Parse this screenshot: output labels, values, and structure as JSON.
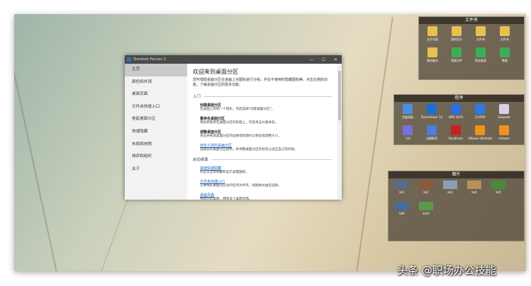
{
  "window": {
    "title": "Stardock Fences 3",
    "controls": [
      "—",
      "☐",
      "✕"
    ]
  },
  "sidebar": [
    "主页",
    "颜色和外观",
    "桌面页面",
    "文件夹快速入口",
    "卷起桌面分区",
    "快速隐藏",
    "布局和快照",
    "排序和组织",
    "关于"
  ],
  "main": {
    "heading": "欢迎来到桌面分区",
    "desc": "您可借助桌面分区在桌面上对图标进行分组，并在不使用时隐藏图标等。点击左侧的功能，了解桌面分区的更多功能。",
    "sections": [
      {
        "title": "入门",
        "items": [
          {
            "t": "创建桌面分区",
            "d": "在桌面上绘制一个矩形，然后选择\"创建桌面分区\"。",
            "link": false
          },
          {
            "t": "重命名桌面分区",
            "d": "将鼠标悬停在桌面分区的标题上，然后单击以重命名。",
            "link": false
          },
          {
            "t": "调整桌面分区",
            "d": "单击并拖动桌面分区的边缘或标题栏以移动或调整大小。",
            "link": false
          },
          {
            "t": "自定义您的桌面分区",
            "d": "选择您的桌面分区颜色，并调整桌面分区的标签以适应自己的风格。",
            "link": true
          }
        ]
      },
      {
        "title": "启动桌面",
        "items": [
          {
            "t": "桌面快速隐藏",
            "d": "双击以立即隐藏和显示桌面图标。",
            "link": true
          },
          {
            "t": "文件夹快捷入口",
            "d": "方便地从桌面分区访问任何文件夹，视图样式由您选择。",
            "link": true
          },
          {
            "t": "桌面页面",
            "d": "整理您的桌面，拥有多个桌面页面。",
            "link": true
          }
        ]
      }
    ]
  },
  "fences": [
    {
      "title": "文件夹",
      "items": [
        {
          "l": "文件归档",
          "c": "#e8c050"
        },
        {
          "l": "我的音乐",
          "c": "#e8c050"
        },
        {
          "l": "文件夹",
          "c": "#e8c050"
        },
        {
          "l": "文件夹",
          "c": "#e8c050"
        },
        {
          "l": "素材备份",
          "c": "#e8c050"
        },
        {
          "l": "表格文件",
          "c": "#3cae5a"
        },
        {
          "l": "财务报表",
          "c": "#3cae5a"
        },
        {
          "l": "数据",
          "c": "#3cae5a"
        }
      ]
    },
    {
      "title": "程序",
      "items": [
        {
          "l": "百度网盘",
          "c": "#4a90e2"
        },
        {
          "l": "TeamViewer 14",
          "c": "#1a6fd6"
        },
        {
          "l": "WPS 2019",
          "c": "#2b6fe6"
        },
        {
          "l": "万兴PDF",
          "c": "#2a7ae0"
        },
        {
          "l": "Snipaste",
          "c": "#d8d0e8"
        },
        {
          "l": "飞书",
          "c": "#7a6fe0"
        },
        {
          "l": "迅雷影音",
          "c": "#4a7ee0"
        },
        {
          "l": "Bandicam",
          "c": "#c82020"
        },
        {
          "l": "VMware Workstation",
          "c": "#f0901e"
        },
        {
          "l": "vmware",
          "c": "#f0901e"
        }
      ]
    },
    {
      "title": "图片",
      "items": [
        {
          "l": "bz1",
          "c": "#5a6a8a"
        },
        {
          "l": "bz2",
          "c": "#8a5a3a"
        },
        {
          "l": "bz3",
          "c": "#8aa0b8"
        },
        {
          "l": "bz4",
          "c": "#b89058"
        },
        {
          "l": "bz5",
          "c": "#4a8a3a"
        },
        {
          "l": "bz6",
          "c": "#4a6a9a"
        },
        {
          "l": "bz10",
          "c": "#5a9a4a"
        }
      ]
    }
  ],
  "watermark": "头条 @职场办公技能"
}
